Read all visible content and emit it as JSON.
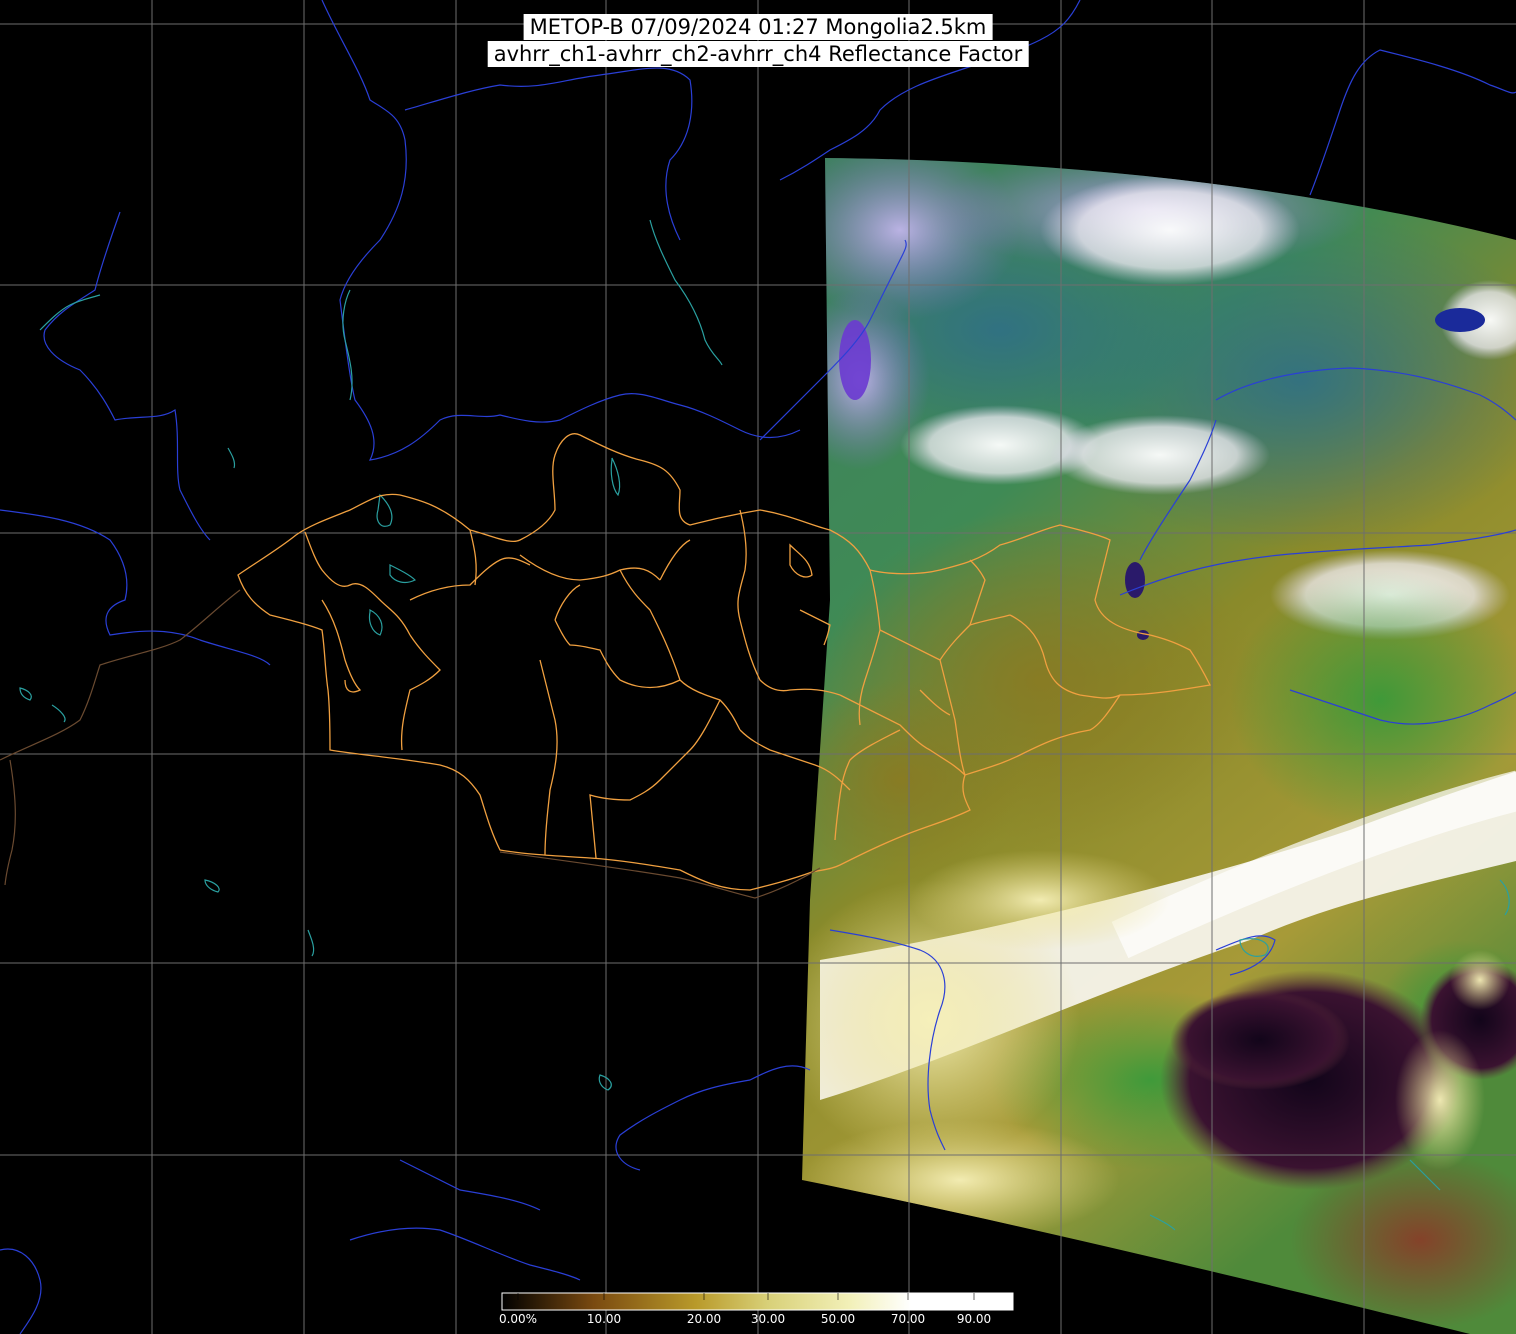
{
  "title": {
    "line1": "METOP-B 07/09/2024 01:27 Mongolia2.5km",
    "line2": "avhrr_ch1-avhrr_ch2-avhrr_ch4 Reflectance Factor"
  },
  "colorbar": {
    "tick_labels": [
      "0.00%",
      "10.00",
      "20.00",
      "30.00",
      "50.00",
      "70.00",
      "90.00"
    ],
    "stops": [
      {
        "value": 0,
        "color": "#000000"
      },
      {
        "value": 10,
        "color": "#7a4a10"
      },
      {
        "value": 20,
        "color": "#b99a2a"
      },
      {
        "value": 30,
        "color": "#d8d078"
      },
      {
        "value": 50,
        "color": "#f2f0b8"
      },
      {
        "value": 70,
        "color": "#ffffff"
      },
      {
        "value": 90,
        "color": "#ffffff"
      }
    ]
  },
  "colors": {
    "background": "#000000",
    "graticule": "#6e6e6e",
    "coastline_river": "#2a3fd6",
    "lake_outline": "#2aa0a0",
    "admin_border": "#f0a040",
    "cloud": "#f5f2ee",
    "vegetation_green": "#3f8a42",
    "steppe_olive": "#8a8a28",
    "sea_dark": "#2b0f24",
    "desert_yellow": "#e6dc80"
  },
  "map": {
    "region": "Mongolia",
    "satellite": "METOP-B",
    "resolution": "2.5km"
  }
}
